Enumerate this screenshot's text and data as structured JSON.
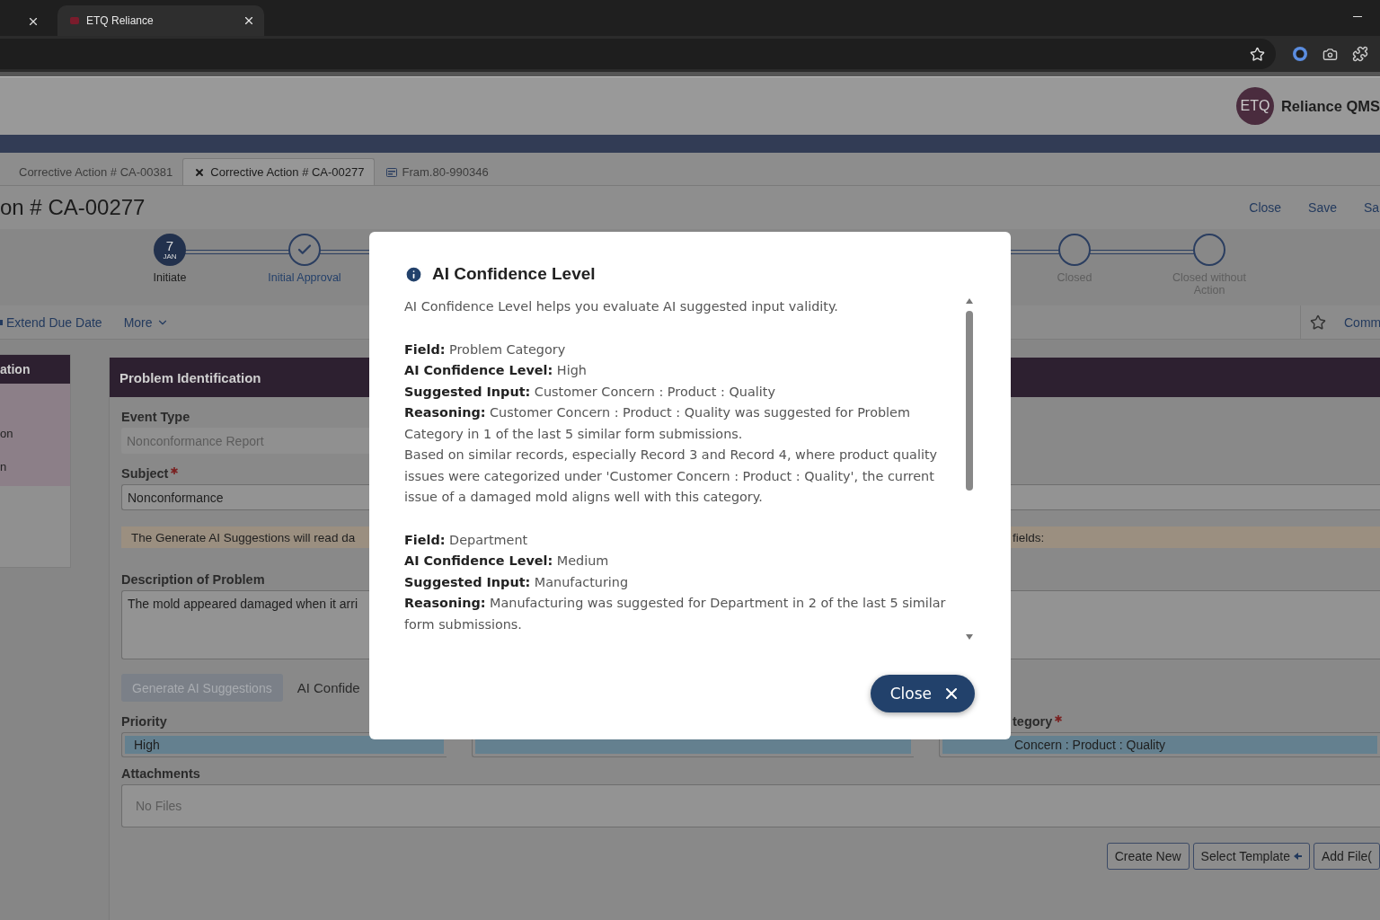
{
  "browser": {
    "tab": {
      "title": "ETQ Reliance",
      "selected": true
    }
  },
  "app": {
    "brand": "ETQ",
    "product": "Reliance QMS"
  },
  "document_tabs": [
    {
      "label": "Corrective Action # CA-00381",
      "selected": false,
      "kind": "plain"
    },
    {
      "label": "Corrective Action # CA-00277",
      "selected": true,
      "kind": "close"
    },
    {
      "label": "Fram.80-990346",
      "selected": false,
      "kind": "form"
    }
  ],
  "title": "on # CA-00277",
  "actions": [
    "Close",
    "Save",
    "Sa"
  ],
  "stepper": [
    {
      "label": "Initiate",
      "kind": "date",
      "day": "7",
      "month": "JAN"
    },
    {
      "label": "Initial Approval",
      "kind": "done"
    },
    {
      "label": "Closed",
      "kind": "pending"
    },
    {
      "label": "Closed without Action",
      "kind": "pending"
    }
  ],
  "toolbar": {
    "items": [
      {
        "label": "Extend Due Date",
        "kind": "edit"
      },
      {
        "label": "More",
        "kind": "menu"
      }
    ],
    "right": "Comm"
  },
  "sidebar": {
    "title": "ation",
    "items": [
      "on",
      "n"
    ]
  },
  "form": {
    "title": "Problem Identification",
    "event_type": {
      "label": "Event Type",
      "value": "Nonconformance Report"
    },
    "subject": {
      "label": "Subject",
      "required": true,
      "value": "Nonconformance"
    },
    "notice": {
      "left": "The Generate AI Suggestions will read da",
      "right": "fields:"
    },
    "description": {
      "label": "Description of Problem",
      "value": "The mold appeared damaged when it arri"
    },
    "generate_button": "Generate AI Suggestions",
    "confidence_link": "AI Confide",
    "priority": {
      "label": "Priority",
      "value": "High"
    },
    "category": {
      "label": "tegory",
      "required": true,
      "value": "Concern : Product : Quality"
    },
    "attachments": {
      "label": "Attachments",
      "placeholder": "No Files"
    },
    "buttons": [
      "Create New",
      "Select Template",
      "Add File("
    ]
  },
  "modal": {
    "title": "AI Confidence Level",
    "intro": "AI Confidence Level helps you evaluate AI suggested input validity.",
    "sections": [
      {
        "lines": [
          "**Field:** Problem Category",
          "**AI Confidence Level:** High",
          "**Suggested Input:** Customer Concern : Product : Quality",
          "**Reasoning:** Customer Concern : Product : Quality was suggested for Problem Category in 1 of the last 5 similar form submissions."
        ],
        "note": "Based on similar records, especially Record 3 and Record 4, where product quality issues were categorized under 'Customer Concern : Product : Quality', the current issue of a damaged mold aligns well with this category."
      },
      {
        "lines": [
          "**Field:** Department",
          "**AI Confidence Level:** Medium",
          "**Suggested Input:** Manufacturing",
          "**Reasoning:** Manufacturing was suggested for Department in 2 of the last 5 similar form submissions."
        ]
      }
    ],
    "close_button": "Close"
  }
}
